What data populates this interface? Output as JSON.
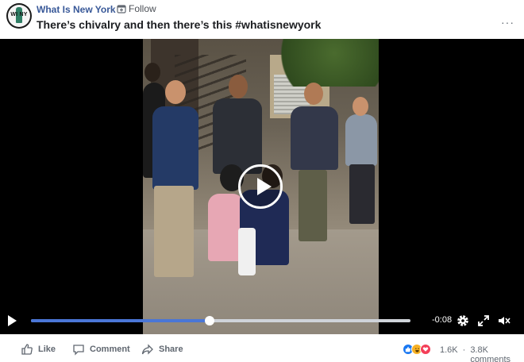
{
  "post": {
    "page_name": "What Is New York",
    "separator": "·",
    "follow_label": "Follow",
    "title": "There’s chivalry and then there’s this #whatisnewyork",
    "more_label": "···",
    "avatar_text": "WI  NY"
  },
  "video": {
    "time_remaining": "-0:08",
    "progress_fraction": 0.47
  },
  "footer": {
    "like_label": "Like",
    "comment_label": "Comment",
    "share_label": "Share",
    "reaction_count": "1.6K",
    "separator": "·",
    "comments_count": "3.8K comments",
    "reaction_icons": [
      "like-reaction-icon",
      "haha-reaction-icon",
      "love-reaction-icon"
    ]
  },
  "colors": {
    "page_link": "#385898",
    "progress": "#4a76d6",
    "like": "#1877f2",
    "love": "#f33e58",
    "haha": "#f7b125"
  }
}
